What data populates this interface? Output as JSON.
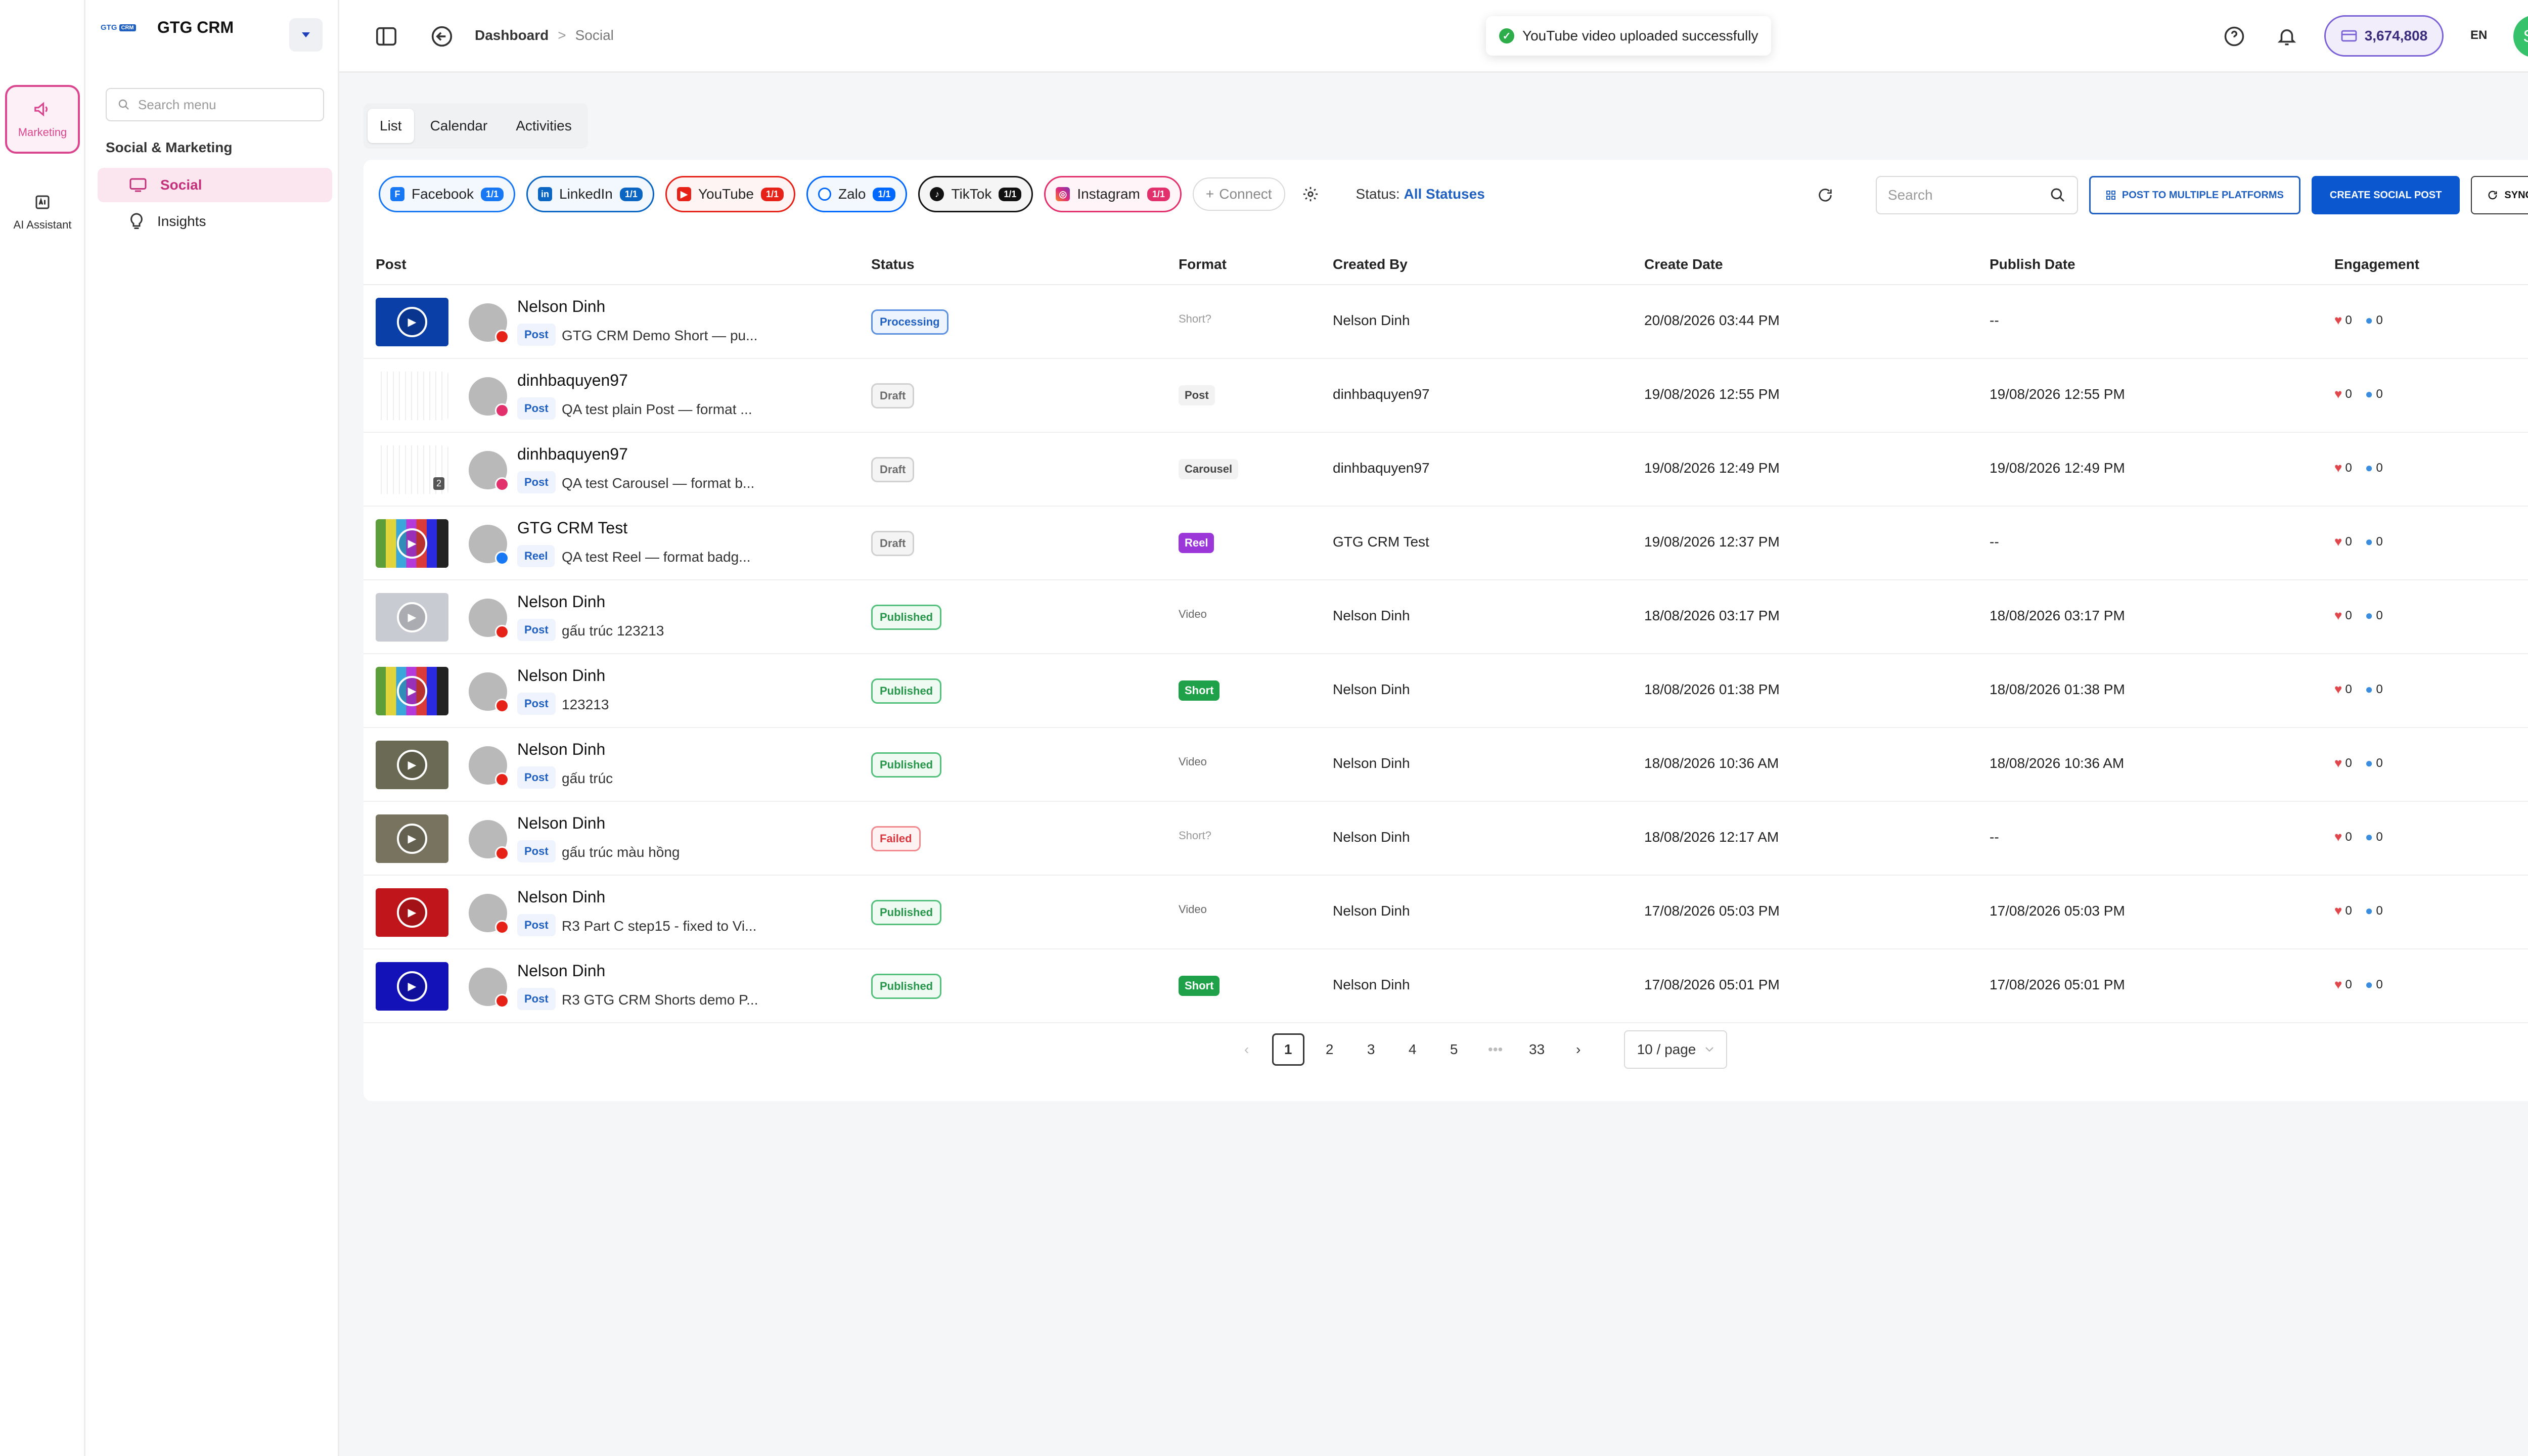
{
  "app": {
    "logo_text": "GTG",
    "logo_chip": "CRM",
    "name": "GTG CRM"
  },
  "rail": {
    "marketing_label": "Marketing",
    "ai_label": "AI Assistant"
  },
  "sidebar": {
    "search_placeholder": "Search menu",
    "section_title": "Social & Marketing",
    "items": [
      {
        "label": "Social",
        "icon": "monitor-icon"
      },
      {
        "label": "Insights",
        "icon": "bulb-icon"
      }
    ]
  },
  "header": {
    "breadcrumb": {
      "root": "Dashboard",
      "separator": ">",
      "current": "Social"
    },
    "toast": "YouTube video uploaded successfully",
    "balance": "3,674,808",
    "language": "EN",
    "avatar_initials": "SP"
  },
  "tabs": [
    "List",
    "Calendar",
    "Activities"
  ],
  "platforms": [
    {
      "name": "Facebook",
      "count": "1/1",
      "icon": "F"
    },
    {
      "name": "LinkedIn",
      "count": "1/1",
      "icon": "in"
    },
    {
      "name": "YouTube",
      "count": "1/1",
      "icon": "▶"
    },
    {
      "name": "Zalo",
      "count": "1/1",
      "icon": ""
    },
    {
      "name": "TikTok",
      "count": "1/1",
      "icon": "♪"
    },
    {
      "name": "Instagram",
      "count": "1/1",
      "icon": "◎"
    }
  ],
  "toolbar": {
    "connect_label": "Connect",
    "status_label": "Status:",
    "status_value": "All Statuses",
    "search_placeholder": "Search",
    "post_multi_label": "POST TO MULTIPLE PLATFORMS",
    "create_label": "CREATE SOCIAL POST",
    "sync_label": "SYNC"
  },
  "table": {
    "columns": [
      "Post",
      "Status",
      "Format",
      "Created By",
      "Create Date",
      "Publish Date",
      "Engagement"
    ],
    "rows": [
      {
        "name": "Nelson Dinh",
        "tag": "Post",
        "text": "GTG CRM Demo Short — pu...",
        "status": "Processing",
        "format": "Short?",
        "created_by": "Nelson Dinh",
        "create_date": "20/08/2026 03:44 PM",
        "publish_date": "--",
        "likes": "0",
        "comments": "0"
      },
      {
        "name": "dinhbaquyen97",
        "tag": "Post",
        "text": "QA test plain Post — format ...",
        "status": "Draft",
        "format": "Post",
        "created_by": "dinhbaquyen97",
        "create_date": "19/08/2026 12:55 PM",
        "publish_date": "19/08/2026 12:55 PM",
        "likes": "0",
        "comments": "0"
      },
      {
        "name": "dinhbaquyen97",
        "tag": "Post",
        "text": "QA test Carousel — format b...",
        "status": "Draft",
        "format": "Carousel",
        "created_by": "dinhbaquyen97",
        "create_date": "19/08/2026 12:49 PM",
        "publish_date": "19/08/2026 12:49 PM",
        "likes": "0",
        "comments": "0",
        "thumb_badge": "2"
      },
      {
        "name": "GTG CRM Test",
        "tag": "Reel",
        "text": "QA test Reel — format badg...",
        "status": "Draft",
        "format": "Reel",
        "created_by": "GTG CRM Test",
        "create_date": "19/08/2026 12:37 PM",
        "publish_date": "--",
        "likes": "0",
        "comments": "0"
      },
      {
        "name": "Nelson Dinh",
        "tag": "Post",
        "text": "gấu trúc 123213",
        "status": "Published",
        "format": "Video",
        "created_by": "Nelson Dinh",
        "create_date": "18/08/2026 03:17 PM",
        "publish_date": "18/08/2026 03:17 PM",
        "likes": "0",
        "comments": "0"
      },
      {
        "name": "Nelson Dinh",
        "tag": "Post",
        "text": "123213",
        "status": "Published",
        "format": "Short",
        "created_by": "Nelson Dinh",
        "create_date": "18/08/2026 01:38 PM",
        "publish_date": "18/08/2026 01:38 PM",
        "likes": "0",
        "comments": "0"
      },
      {
        "name": "Nelson Dinh",
        "tag": "Post",
        "text": "gấu trúc",
        "status": "Published",
        "format": "Video",
        "created_by": "Nelson Dinh",
        "create_date": "18/08/2026 10:36 AM",
        "publish_date": "18/08/2026 10:36 AM",
        "likes": "0",
        "comments": "0"
      },
      {
        "name": "Nelson Dinh",
        "tag": "Post",
        "text": "gấu trúc màu hồng",
        "status": "Failed",
        "format": "Short?",
        "created_by": "Nelson Dinh",
        "create_date": "18/08/2026 12:17 AM",
        "publish_date": "--",
        "likes": "0",
        "comments": "0"
      },
      {
        "name": "Nelson Dinh",
        "tag": "Post",
        "text": "R3 Part C step15 - fixed to Vi...",
        "status": "Published",
        "format": "Video",
        "created_by": "Nelson Dinh",
        "create_date": "17/08/2026 05:03 PM",
        "publish_date": "17/08/2026 05:03 PM",
        "likes": "0",
        "comments": "0"
      },
      {
        "name": "Nelson Dinh",
        "tag": "Post",
        "text": "R3 GTG CRM Shorts demo P...",
        "status": "Published",
        "format": "Short",
        "created_by": "Nelson Dinh",
        "create_date": "17/08/2026 05:01 PM",
        "publish_date": "17/08/2026 05:01 PM",
        "likes": "0",
        "comments": "0"
      }
    ]
  },
  "pagination": {
    "pages": [
      "1",
      "2",
      "3",
      "4",
      "5"
    ],
    "ellipsis": "•••",
    "last": "33",
    "current": "1",
    "page_size": "10 / page"
  },
  "colors": {
    "accent": "#d9468d",
    "primary": "#0b57d0",
    "link": "#1f5fbf"
  }
}
